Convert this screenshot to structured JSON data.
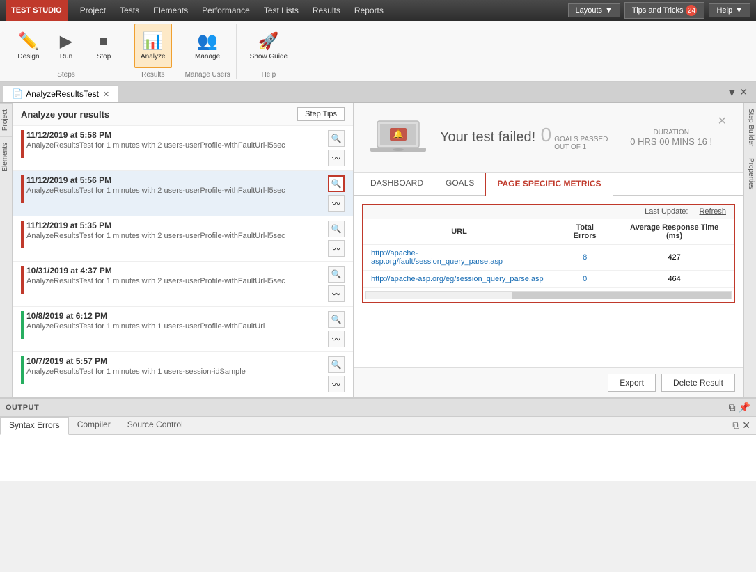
{
  "app": {
    "title": "TEST STUDIO"
  },
  "menu": {
    "items": [
      "Project",
      "Tests",
      "Elements",
      "Performance",
      "Test Lists",
      "Results",
      "Reports"
    ]
  },
  "top_right": {
    "layouts_label": "Layouts",
    "tips_label": "Tips and Tricks",
    "tips_badge": "24",
    "help_label": "Help"
  },
  "toolbar": {
    "groups": [
      {
        "label": "Steps",
        "buttons": [
          {
            "id": "design",
            "label": "Design",
            "icon": "🖊"
          },
          {
            "id": "run",
            "label": "Run",
            "icon": "▶"
          },
          {
            "id": "stop",
            "label": "Stop",
            "icon": "⏹"
          }
        ]
      },
      {
        "label": "Results",
        "buttons": [
          {
            "id": "analyze",
            "label": "Analyze",
            "icon": "📊",
            "active": true
          }
        ]
      },
      {
        "label": "Manage Users",
        "buttons": [
          {
            "id": "manage",
            "label": "Manage",
            "icon": "👥"
          }
        ]
      },
      {
        "label": "Help",
        "buttons": [
          {
            "id": "show_guide",
            "label": "Show\nGuide",
            "icon": "🚀"
          }
        ]
      }
    ]
  },
  "side_left": {
    "labels": [
      "Project",
      "Elements"
    ]
  },
  "side_right": {
    "labels": [
      "Step Builder",
      "Properties"
    ]
  },
  "panel": {
    "tab_label": "AnalyzeResultsTest",
    "title": "Analyze your results",
    "step_tips_btn": "Step Tips"
  },
  "test_items": [
    {
      "date": "11/12/2019 at 5:58 PM",
      "desc": "AnalyzeResultsTest for 1 minutes with 2 users-userProfile-withFaultUrl-l5sec",
      "status": "red"
    },
    {
      "date": "11/12/2019 at 5:56 PM",
      "desc": "AnalyzeResultsTest for 1 minutes with 2 users-userProfile-withFaultUrl-l5sec",
      "status": "red",
      "selected": true
    },
    {
      "date": "11/12/2019 at 5:35 PM",
      "desc": "AnalyzeResultsTest for 1 minutes with 2 users-userProfile-withFaultUrl-l5sec",
      "status": "red"
    },
    {
      "date": "10/31/2019 at 4:37 PM",
      "desc": "AnalyzeResultsTest for 1 minutes with 2 users-userProfile-withFaultUrl-l5sec",
      "status": "red"
    },
    {
      "date": "10/8/2019 at 6:12 PM",
      "desc": "AnalyzeResultsTest for 1 minutes with 1 users-userProfile-withFaultUrl",
      "status": "green"
    },
    {
      "date": "10/7/2019 at 5:57 PM",
      "desc": "AnalyzeResultsTest for 1 minutes with 1 users-session-idSample",
      "status": "green"
    }
  ],
  "result_banner": {
    "title": "Your test failed!",
    "goals_number": "0",
    "goals_label": "GOALS PASSED\nOUT OF 1",
    "duration_label": "DURATION",
    "duration_value": "0 HRS  00 MINS  16 !"
  },
  "metrics_tabs": {
    "tabs": [
      "DASHBOARD",
      "GOALS",
      "PAGE SPECIFIC METRICS"
    ]
  },
  "metrics_table": {
    "last_update_label": "Last Update:",
    "refresh_label": "Refresh",
    "columns": [
      "URL",
      "Total Errors",
      "Average Response Time (ms)"
    ],
    "rows": [
      {
        "url": "http://apache-asp.org/fault/session_query_parse.asp",
        "errors": "8",
        "avg_response": "427"
      },
      {
        "url": "http://apache-asp.org/eg/session_query_parse.asp",
        "errors": "0",
        "avg_response": "464"
      }
    ]
  },
  "bottom_actions": {
    "export_label": "Export",
    "delete_label": "Delete Result"
  },
  "output_panel": {
    "title": "OUTPUT",
    "tabs": [
      "Syntax Errors",
      "Compiler",
      "Source Control"
    ]
  }
}
